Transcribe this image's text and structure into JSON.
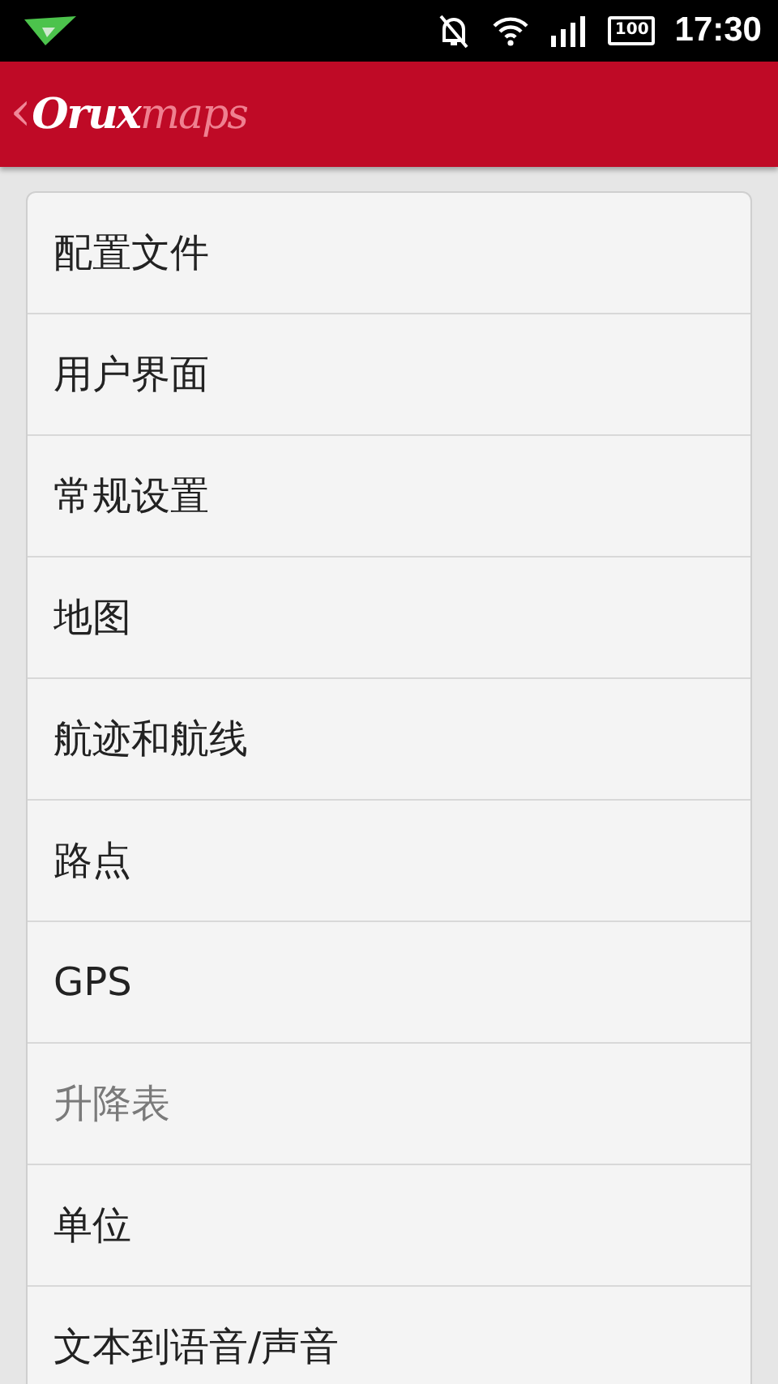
{
  "status_bar": {
    "battery_text": "100",
    "time": "17:30"
  },
  "app_bar": {
    "back": "‹",
    "logo_main": "Orux",
    "logo_accent": "maps"
  },
  "menu": [
    {
      "label": "配置文件",
      "disabled": false
    },
    {
      "label": "用户界面",
      "disabled": false
    },
    {
      "label": "常规设置",
      "disabled": false
    },
    {
      "label": "地图",
      "disabled": false
    },
    {
      "label": "航迹和航线",
      "disabled": false
    },
    {
      "label": "路点",
      "disabled": false
    },
    {
      "label": "GPS",
      "disabled": false
    },
    {
      "label": "升降表",
      "disabled": true
    },
    {
      "label": "单位",
      "disabled": false
    },
    {
      "label": "文本到语音/声音",
      "disabled": false
    }
  ]
}
